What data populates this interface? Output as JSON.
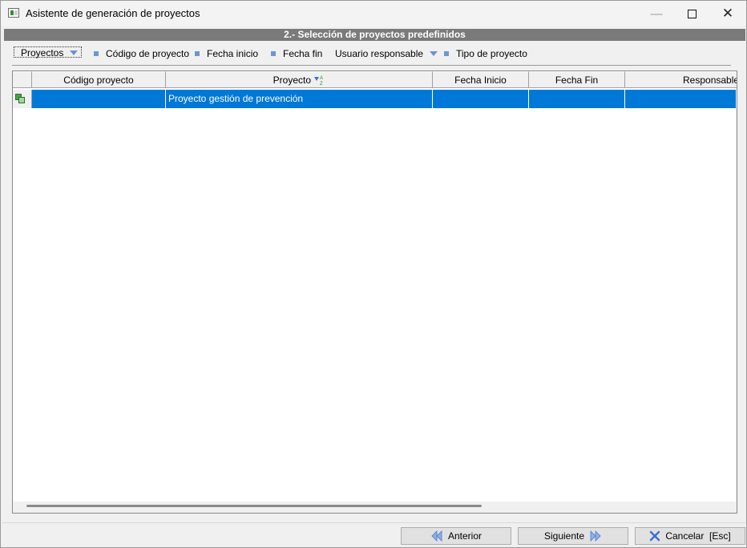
{
  "window": {
    "title": "Asistente de generación de proyectos",
    "minimize_glyph": "—",
    "close_glyph": "✕"
  },
  "section": {
    "title": "2.- Selección de proyectos predefinidos"
  },
  "filter_bar": {
    "items": [
      {
        "label": "Proyectos",
        "kind": "dropdown-button"
      },
      {
        "label": "Código de proyecto",
        "kind": "bullet"
      },
      {
        "label": "Fecha inicio",
        "kind": "bullet"
      },
      {
        "label": "Fecha fin",
        "kind": "bullet"
      },
      {
        "label": "Usuario responsable",
        "kind": "dropdown"
      },
      {
        "label": "Tipo de proyecto",
        "kind": "bullet"
      }
    ]
  },
  "grid": {
    "columns": [
      {
        "label": ""
      },
      {
        "label": "Código proyecto"
      },
      {
        "label": "Proyecto",
        "sort_icon": "sort-az-icon"
      },
      {
        "label": "Fecha Inicio"
      },
      {
        "label": "Fecha Fin"
      },
      {
        "label": "Responsable de"
      }
    ],
    "rows": [
      {
        "codigo": "",
        "proyecto": "Proyecto gestión de prevención",
        "fecha_inicio": "",
        "fecha_fin": "",
        "responsable": "",
        "selected": true
      }
    ]
  },
  "footer": {
    "prev_label": "Anterior",
    "next_label": "Siguiente",
    "cancel_label": "Cancelar  [Esc]"
  },
  "colors": {
    "selection": "#0078d7",
    "header_band": "#7a7a7a",
    "accent_icon": "#6f8fd6"
  }
}
